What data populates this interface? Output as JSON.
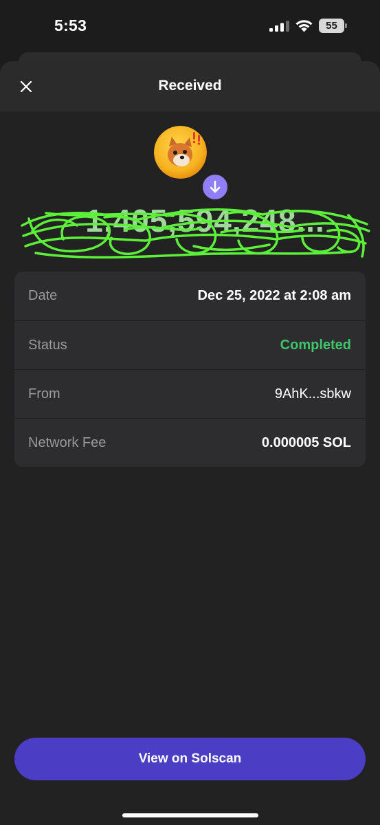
{
  "status_bar": {
    "time": "5:53",
    "battery_level": "55",
    "icons": [
      "signal-icon",
      "wifi-icon",
      "battery-icon"
    ]
  },
  "header": {
    "title": "Received",
    "close_icon": "close-icon"
  },
  "token": {
    "avatar_icon": "bonk-dog-token-icon",
    "badge_icon": "arrow-down-icon",
    "amount": "1,405,594,248...",
    "amount_redacted": true
  },
  "details": [
    {
      "label": "Date",
      "value": "Dec 25, 2022 at 2:08 am",
      "style": "bold"
    },
    {
      "label": "Status",
      "value": "Completed",
      "style": "green"
    },
    {
      "label": "From",
      "value": "9AhK...sbkw",
      "style": "light"
    },
    {
      "label": "Network Fee",
      "value": "0.000005 SOL",
      "style": "bold"
    }
  ],
  "actions": {
    "view_button": "View on Solscan"
  },
  "colors": {
    "background": "#1c1c1c",
    "sheet": "#222222",
    "card": "#2d2d2f",
    "accent_button": "#4a3fc4",
    "badge": "#8f7ef5",
    "status_completed": "#3ec46d",
    "scribble": "#5cf03a"
  }
}
